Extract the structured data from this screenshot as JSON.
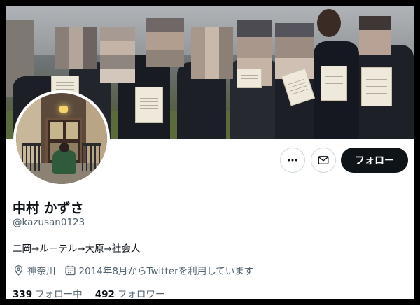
{
  "profile": {
    "display_name": "中村 かずさ",
    "handle": "@kazusan0123",
    "bio": "二岡→ルーテル→大原→社会人",
    "location": "神奈川",
    "joined": "2014年8月からTwitterを利用しています",
    "following_count": "339",
    "following_label": "フォロー中",
    "followers_count": "492",
    "followers_label": "フォロワー"
  },
  "actions": {
    "follow_label": "フォロー"
  },
  "icons": {
    "more": "more-horizontal-icon",
    "message": "envelope-icon",
    "location": "location-pin-icon",
    "calendar": "calendar-icon"
  },
  "colors": {
    "primary_text": "#0f1419",
    "secondary_text": "#536471",
    "button_dark": "#0f1419",
    "border": "#cfd9de"
  }
}
